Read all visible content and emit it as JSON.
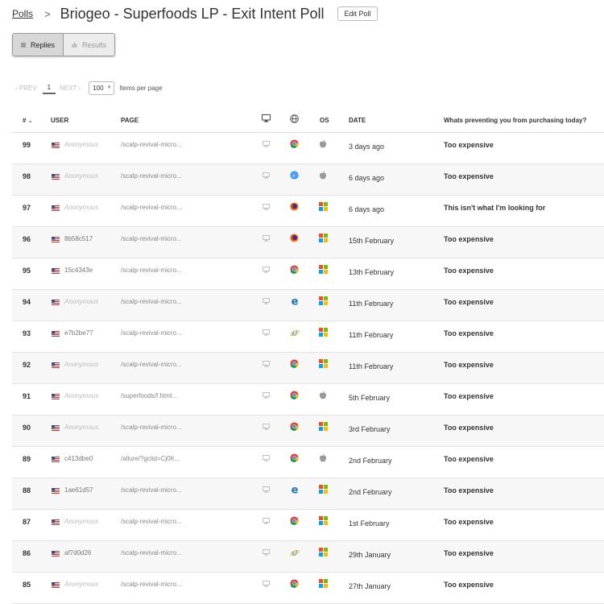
{
  "breadcrumb": {
    "root": "Polls",
    "separator": ">"
  },
  "title": "Briogeo - Superfoods LP - Exit Intent Poll",
  "edit_button": "Edit Poll",
  "tabs": {
    "replies": "Replies",
    "results": "Results"
  },
  "pagination": {
    "prev": "‹ PREV",
    "current": "1",
    "next": "NEXT ›",
    "per_page": "100",
    "per_page_label": "Items per page"
  },
  "columns": {
    "num": "#",
    "user": "USER",
    "page": "PAGE",
    "device_icon": "desktop-icon",
    "browser_icon": "globe-icon",
    "os": "OS",
    "date": "DATE",
    "question": "Whats preventing you from purchasing today?"
  },
  "rows": [
    {
      "num": "99",
      "user": "Anonymous",
      "anon": true,
      "page": "/scalp-revival-micro...",
      "browser": "chrome",
      "os": "apple",
      "date": "3 days ago",
      "answer": "Too expensive"
    },
    {
      "num": "98",
      "user": "Anonymous",
      "anon": true,
      "page": "/scalp-revival-micro...",
      "browser": "safari",
      "os": "apple",
      "date": "6 days ago",
      "answer": "Too expensive"
    },
    {
      "num": "97",
      "user": "Anonymous",
      "anon": true,
      "page": "/scalp-revival-micro...",
      "browser": "firefox",
      "os": "windows",
      "date": "6 days ago",
      "answer": "This isn't what I'm looking for"
    },
    {
      "num": "96",
      "user": "8b58c517",
      "anon": false,
      "page": "/scalp-revival-micro...",
      "browser": "firefox",
      "os": "windows",
      "date": "15th February",
      "answer": "Too expensive"
    },
    {
      "num": "95",
      "user": "15c4343e",
      "anon": false,
      "page": "/scalp-revival-micro...",
      "browser": "chrome",
      "os": "windows",
      "date": "13th February",
      "answer": "Too expensive"
    },
    {
      "num": "94",
      "user": "Anonymous",
      "anon": true,
      "page": "/scalp-revival-micro...",
      "browser": "edge",
      "os": "windows",
      "date": "11th February",
      "answer": "Too expensive"
    },
    {
      "num": "93",
      "user": "e7b2be77",
      "anon": false,
      "page": "/scalp-revival-micro...",
      "browser": "ie",
      "os": "windows",
      "date": "11th February",
      "answer": "Too expensive"
    },
    {
      "num": "92",
      "user": "Anonymous",
      "anon": true,
      "page": "/scalp-revival-micro...",
      "browser": "chrome",
      "os": "windows",
      "date": "11th February",
      "answer": "Too expensive"
    },
    {
      "num": "91",
      "user": "Anonymous",
      "anon": true,
      "page": "/superfoods/f.html...",
      "browser": "chrome",
      "os": "apple",
      "date": "5th February",
      "answer": "Too expensive"
    },
    {
      "num": "90",
      "user": "Anonymous",
      "anon": true,
      "page": "/scalp-revival-micro...",
      "browser": "chrome",
      "os": "windows",
      "date": "3rd February",
      "answer": "Too expensive"
    },
    {
      "num": "89",
      "user": "c413dbe0",
      "anon": false,
      "page": "/allure/?gclid=Cj0K...",
      "browser": "chrome",
      "os": "apple",
      "date": "2nd February",
      "answer": "Too expensive"
    },
    {
      "num": "88",
      "user": "1ae61d57",
      "anon": false,
      "page": "/scalp-revival-micro...",
      "browser": "edge",
      "os": "windows",
      "date": "2nd February",
      "answer": "Too expensive"
    },
    {
      "num": "87",
      "user": "Anonymous",
      "anon": true,
      "page": "/scalp-revival-micro...",
      "browser": "chrome",
      "os": "windows",
      "date": "1st February",
      "answer": "Too expensive"
    },
    {
      "num": "86",
      "user": "af7d0d26",
      "anon": false,
      "page": "/scalp-revival-micro...",
      "browser": "ie",
      "os": "windows",
      "date": "29th January",
      "answer": "Too expensive"
    },
    {
      "num": "85",
      "user": "Anonymous",
      "anon": true,
      "page": "/scalp-revival-micro...",
      "browser": "chrome",
      "os": "windows",
      "date": "27th January",
      "answer": "Too expensive"
    }
  ]
}
